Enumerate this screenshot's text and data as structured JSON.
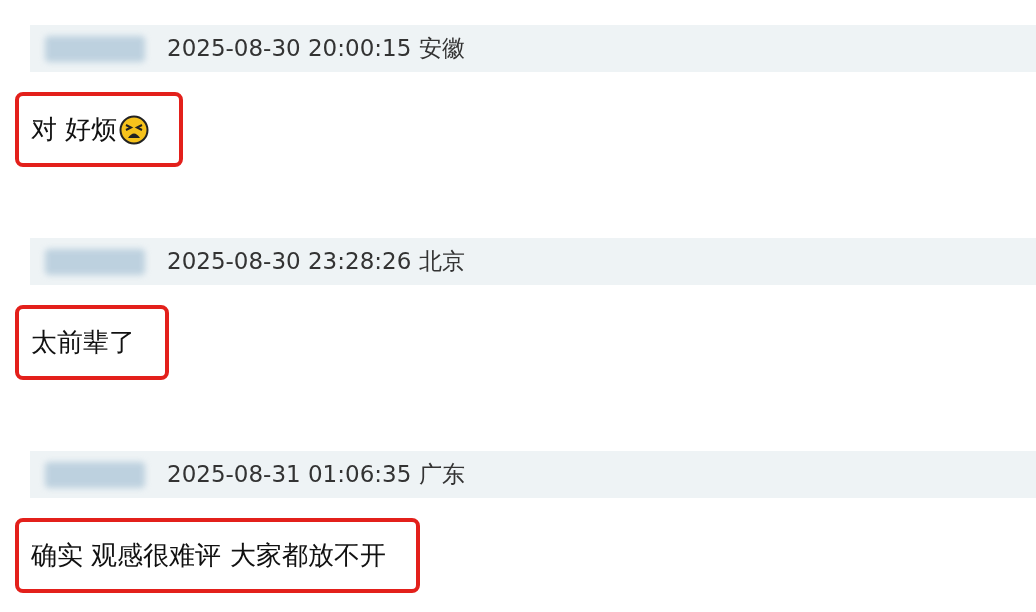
{
  "comments": [
    {
      "timestamp": "2025-08-30 20:00:15",
      "location": "安徽",
      "text": "对 好烦",
      "emoji": true,
      "highlighted": true
    },
    {
      "timestamp": "2025-08-30 23:28:26",
      "location": "北京",
      "text": "太前辈了",
      "emoji": false,
      "highlighted": true
    },
    {
      "timestamp": "2025-08-31 01:06:35",
      "location": "广东",
      "text": "确实 观感很难评 大家都放不开",
      "emoji": false,
      "highlighted": true
    }
  ]
}
